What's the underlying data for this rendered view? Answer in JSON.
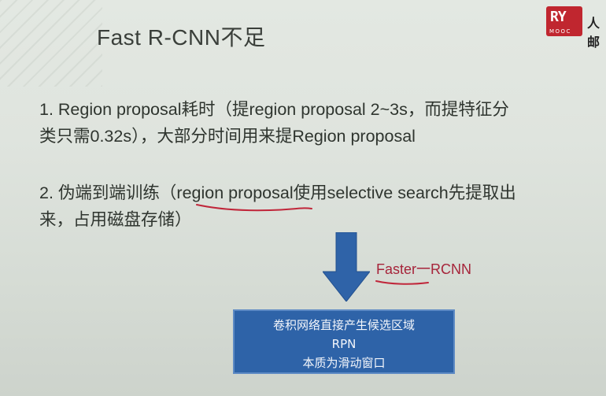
{
  "slide": {
    "title": "Fast R-CNN不足",
    "point1_line1": "1. Region proposal耗时（提region proposal 2~3s，而提特征分",
    "point1_line2": "类只需0.32s），大部分时间用来提Region proposal",
    "point2_line1": "2. 伪端到端训练（region proposal使用selective search先提取出",
    "point2_line2": "来，占用磁盘存储）",
    "annotation": "Faster一RCNN",
    "box_line1": "卷积网络直接产生候选区域",
    "box_line2": "RPN",
    "box_line3": "本质为滑动窗口"
  },
  "logo": {
    "mark": "RY",
    "sub": "MOOC",
    "text": "人邮"
  },
  "colors": {
    "arrow": "#2f63a8",
    "box": "#2e63a8",
    "annotation": "#a6243a",
    "underline": "#c0263a",
    "logo": "#c0262f"
  },
  "icons": [
    "down-arrow-icon",
    "logo-icon"
  ]
}
